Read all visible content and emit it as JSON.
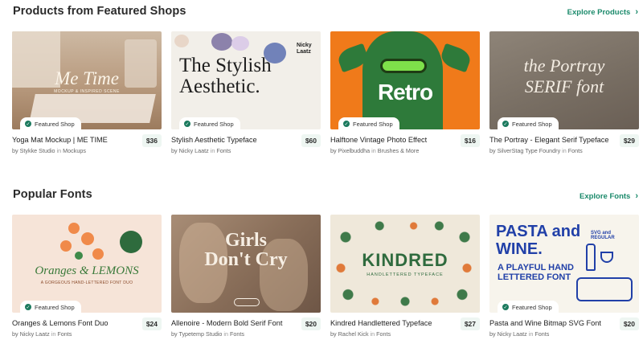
{
  "sections": [
    {
      "heading": "Products from Featured Shops",
      "explore_label": "Explore Products",
      "cards": [
        {
          "title": "Yoga Mat Mockup | ME TIME",
          "by": "by",
          "seller": "Stykke Studio",
          "in": "in",
          "category": "Mockups",
          "price": "$36",
          "badge": "Featured Shop",
          "art_main": "Me Time",
          "art_sub": "MOCKUP & INSPIRED SCENE"
        },
        {
          "title": "Stylish Aesthetic Typeface",
          "by": "by",
          "seller": "Nicky Laatz",
          "in": "in",
          "category": "Fonts",
          "price": "$60",
          "badge": "Featured Shop",
          "art_main": "The Stylish Aesthetic.",
          "art_sub": "Nicky Laatz"
        },
        {
          "title": "Halftone Vintage Photo Effect",
          "by": "by",
          "seller": "Pixelbuddha",
          "in": "in",
          "category": "Brushes & More",
          "price": "$16",
          "badge": "Featured Shop",
          "art_main": "Retro"
        },
        {
          "title": "The Portray - Elegant Serif Typeface",
          "by": "by",
          "seller": "SilverStag Type Foundry",
          "in": "in",
          "category": "Fonts",
          "price": "$29",
          "badge": "Featured Shop",
          "art_main": "the Portray SERIF font"
        }
      ]
    },
    {
      "heading": "Popular Fonts",
      "explore_label": "Explore Fonts",
      "cards": [
        {
          "title": "Oranges & Lemons Font Duo",
          "by": "by",
          "seller": "Nicky Laatz",
          "in": "in",
          "category": "Fonts",
          "price": "$24",
          "badge": "Featured Shop",
          "art_main": "Oranges & LEMONS",
          "art_sub": "A GORGEOUS HAND-LETTERED FONT DUO"
        },
        {
          "title": "Allenoire - Modern Bold Serif Font",
          "by": "by",
          "seller": "Typetemp Studio",
          "in": "in",
          "category": "Fonts",
          "price": "$20",
          "art_main": "Girls Don't Cry"
        },
        {
          "title": "Kindred Handlettered Typeface",
          "by": "by",
          "seller": "Rachel Kick",
          "in": "in",
          "category": "Fonts",
          "price": "$27",
          "art_main": "KINDRED",
          "art_sub": "HANDLETTERED TYPEFACE"
        },
        {
          "title": "Pasta and Wine Bitmap SVG Font",
          "by": "by",
          "seller": "Nicky Laatz",
          "in": "in",
          "category": "Fonts",
          "price": "$20",
          "badge": "Featured Shop",
          "art_main": "PASTA and WINE.",
          "art_sub": "A PLAYFUL HAND LETTERED FONT",
          "art_tag": "SVG and REGULAR"
        }
      ]
    }
  ],
  "colors": {
    "accent": "#1b8a6b",
    "badge_dot": "#1b7a5e",
    "price_bg": "#eef6f2"
  }
}
